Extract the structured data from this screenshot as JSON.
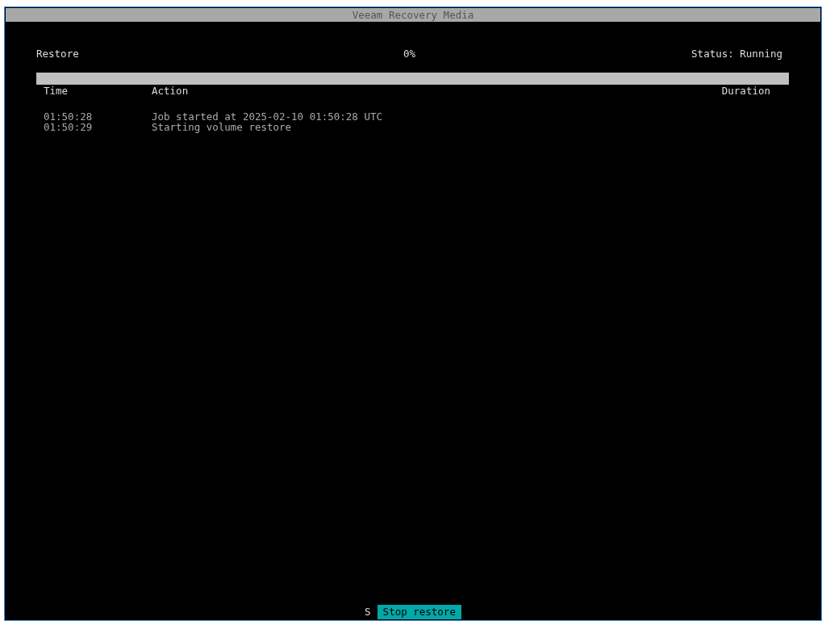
{
  "window": {
    "title": "Veeam Recovery Media"
  },
  "job": {
    "name": "Restore",
    "percent": "0%",
    "status": "Status: Running",
    "level": 0
  },
  "log": {
    "columns": [
      "Time",
      "Action",
      "Duration"
    ],
    "rows": [
      {
        "time": "01:50:28",
        "action": "Job started at 2025-02-10 01:50:28 UTC"
      },
      {
        "time": "01:50:29",
        "action": "Starting volume restore"
      }
    ]
  },
  "footer": {
    "hotkey": "S",
    "button": "Stop restore"
  }
}
